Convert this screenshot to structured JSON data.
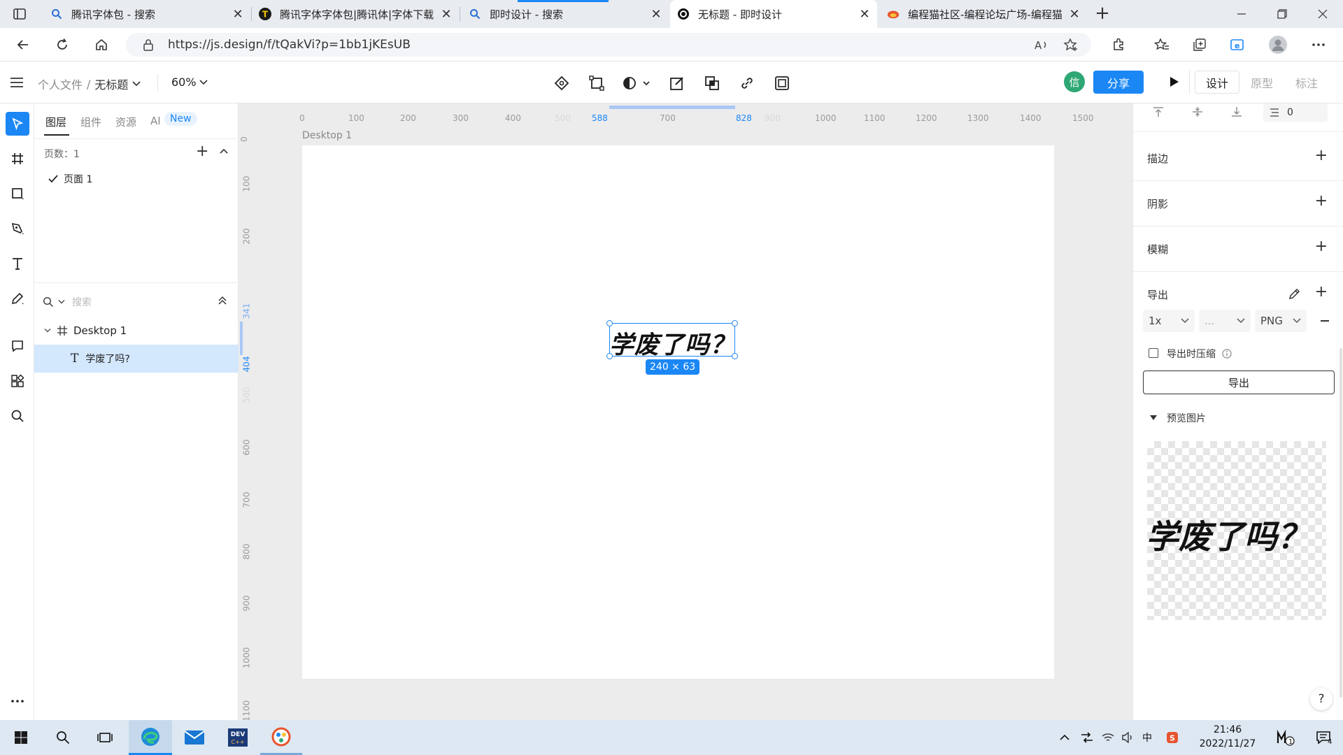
{
  "browser": {
    "tabs": [
      {
        "title": "腾讯字体包 - 搜索",
        "icon": "search-favicon"
      },
      {
        "title": "腾讯字体字体包|腾讯体|字体下载",
        "icon": "font-site-favicon"
      },
      {
        "title": "即时设计 - 搜索",
        "icon": "search-favicon"
      },
      {
        "title": "无标题 - 即时设计",
        "icon": "jsdesign-favicon",
        "active": true
      },
      {
        "title": "编程猫社区-编程论坛广场-编程猫",
        "icon": "codemao-favicon"
      }
    ],
    "url": "https://js.design/f/tQakVi?p=1bb1jKEsUB"
  },
  "app": {
    "breadcrumb_root": "个人文件",
    "breadcrumb_sep": "/",
    "file_name": "无标题",
    "zoom": "60%",
    "avatar_letter": "信",
    "share_label": "分享",
    "mode_tabs": [
      "设计",
      "原型",
      "标注"
    ],
    "active_mode": "设计",
    "accent": "#1b87f5"
  },
  "layers_panel": {
    "tabs": [
      "图层",
      "组件",
      "资源",
      "AI"
    ],
    "new_badge": "New",
    "pages_label": "页数：1",
    "pages": [
      "页面 1"
    ],
    "search_placeholder": "搜索",
    "layers": [
      {
        "name": "Desktop 1",
        "type": "frame"
      },
      {
        "name": "学废了吗?",
        "type": "text",
        "selected": true
      }
    ]
  },
  "canvas": {
    "frame_label": "Desktop 1",
    "text_content": "学废了吗？",
    "size_badge": "240 × 63",
    "h_ruler_ticks": [
      "0",
      "100",
      "200",
      "300",
      "400",
      "500",
      "588",
      "700",
      "828",
      "900",
      "1000",
      "1100",
      "1200",
      "1300",
      "1400",
      "1500"
    ],
    "v_ruler_ticks": [
      "0",
      "100",
      "200",
      "341",
      "404",
      "500",
      "600",
      "700",
      "800",
      "900",
      "1000",
      "1100"
    ]
  },
  "inspector": {
    "spacing_value": "0",
    "sections": [
      "描边",
      "阴影",
      "模糊"
    ],
    "export_label": "导出",
    "export_scale": "1x",
    "export_suffix": "...",
    "export_format": "PNG",
    "compress_label": "导出时压缩",
    "export_button": "导出",
    "preview_label": "预览图片",
    "preview_text": "学废了吗？"
  },
  "taskbar": {
    "time": "21:46",
    "date": "2022/11/27",
    "ime": "中",
    "notification_count": "4",
    "badge_count": "1"
  }
}
